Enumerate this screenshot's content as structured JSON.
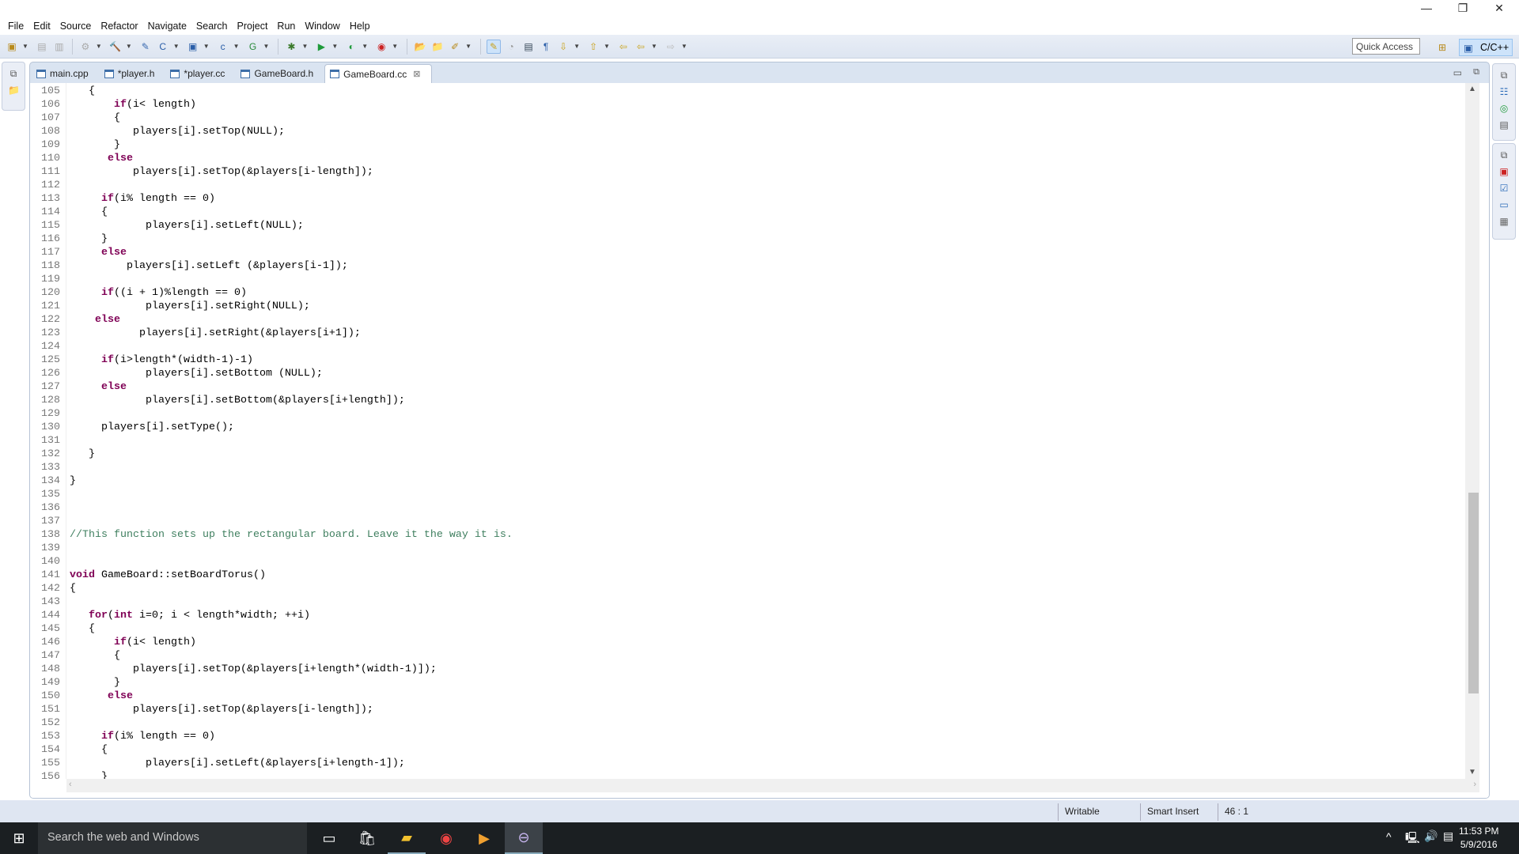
{
  "window": {
    "minimize": "—",
    "restore": "❐",
    "close": "✕"
  },
  "menu": [
    "File",
    "Edit",
    "Source",
    "Refactor",
    "Navigate",
    "Search",
    "Project",
    "Run",
    "Window",
    "Help"
  ],
  "toolbar": {
    "quick_access": "Quick Access",
    "perspective": "C/C++"
  },
  "tabs": [
    {
      "label": "main.cpp",
      "active": false
    },
    {
      "label": "*player.h",
      "active": false
    },
    {
      "label": "*player.cc",
      "active": false
    },
    {
      "label": "GameBoard.h",
      "active": false
    },
    {
      "label": "GameBoard.cc",
      "active": true
    }
  ],
  "editor": {
    "colors": {
      "keyword": "#7f0055",
      "comment": "#3f7f5f",
      "line_number": "#787878"
    },
    "lines": [
      {
        "n": "105",
        "text": "   {"
      },
      {
        "n": "106",
        "text": "       if(i< length)"
      },
      {
        "n": "107",
        "text": "       {"
      },
      {
        "n": "108",
        "text": "          players[i].setTop(NULL);"
      },
      {
        "n": "109",
        "text": "       }"
      },
      {
        "n": "110",
        "text": "      else"
      },
      {
        "n": "111",
        "text": "          players[i].setTop(&players[i-length]);"
      },
      {
        "n": "112",
        "text": ""
      },
      {
        "n": "113",
        "text": "     if(i% length == 0)"
      },
      {
        "n": "114",
        "text": "     {"
      },
      {
        "n": "115",
        "text": "            players[i].setLeft(NULL);"
      },
      {
        "n": "116",
        "text": "     }"
      },
      {
        "n": "117",
        "text": "     else"
      },
      {
        "n": "118",
        "text": "         players[i].setLeft (&players[i-1]);"
      },
      {
        "n": "119",
        "text": ""
      },
      {
        "n": "120",
        "text": "     if((i + 1)%length == 0)"
      },
      {
        "n": "121",
        "text": "            players[i].setRight(NULL);"
      },
      {
        "n": "122",
        "text": "    else"
      },
      {
        "n": "123",
        "text": "           players[i].setRight(&players[i+1]);"
      },
      {
        "n": "124",
        "text": ""
      },
      {
        "n": "125",
        "text": "     if(i>length*(width-1)-1)"
      },
      {
        "n": "126",
        "text": "            players[i].setBottom (NULL);"
      },
      {
        "n": "127",
        "text": "     else"
      },
      {
        "n": "128",
        "text": "            players[i].setBottom(&players[i+length]);"
      },
      {
        "n": "129",
        "text": ""
      },
      {
        "n": "130",
        "text": "     players[i].setType();"
      },
      {
        "n": "131",
        "text": ""
      },
      {
        "n": "132",
        "text": "   }"
      },
      {
        "n": "133",
        "text": ""
      },
      {
        "n": "134",
        "text": "}"
      },
      {
        "n": "135",
        "text": ""
      },
      {
        "n": "136",
        "text": ""
      },
      {
        "n": "137",
        "text": ""
      },
      {
        "n": "138",
        "text": "//This function sets up the rectangular board. Leave it the way it is."
      },
      {
        "n": "139",
        "text": ""
      },
      {
        "n": "140",
        "text": ""
      },
      {
        "n": "141",
        "text": "void GameBoard::setBoardTorus()"
      },
      {
        "n": "142",
        "text": "{"
      },
      {
        "n": "143",
        "text": ""
      },
      {
        "n": "144",
        "text": "   for(int i=0; i < length*width; ++i)"
      },
      {
        "n": "145",
        "text": "   {"
      },
      {
        "n": "146",
        "text": "       if(i< length)"
      },
      {
        "n": "147",
        "text": "       {"
      },
      {
        "n": "148",
        "text": "          players[i].setTop(&players[i+length*(width-1)]);"
      },
      {
        "n": "149",
        "text": "       }"
      },
      {
        "n": "150",
        "text": "      else"
      },
      {
        "n": "151",
        "text": "          players[i].setTop(&players[i-length]);"
      },
      {
        "n": "152",
        "text": ""
      },
      {
        "n": "153",
        "text": "     if(i% length == 0)"
      },
      {
        "n": "154",
        "text": "     {"
      },
      {
        "n": "155",
        "text": "            players[i].setLeft(&players[i+length-1]);"
      },
      {
        "n": "156",
        "text": "     }"
      }
    ]
  },
  "statusbar": {
    "writable": "Writable",
    "insert_mode": "Smart Insert",
    "position": "46 : 1"
  },
  "taskbar": {
    "search_placeholder": "Search the web and Windows",
    "time": "11:53 PM",
    "date": "5/9/2016"
  }
}
